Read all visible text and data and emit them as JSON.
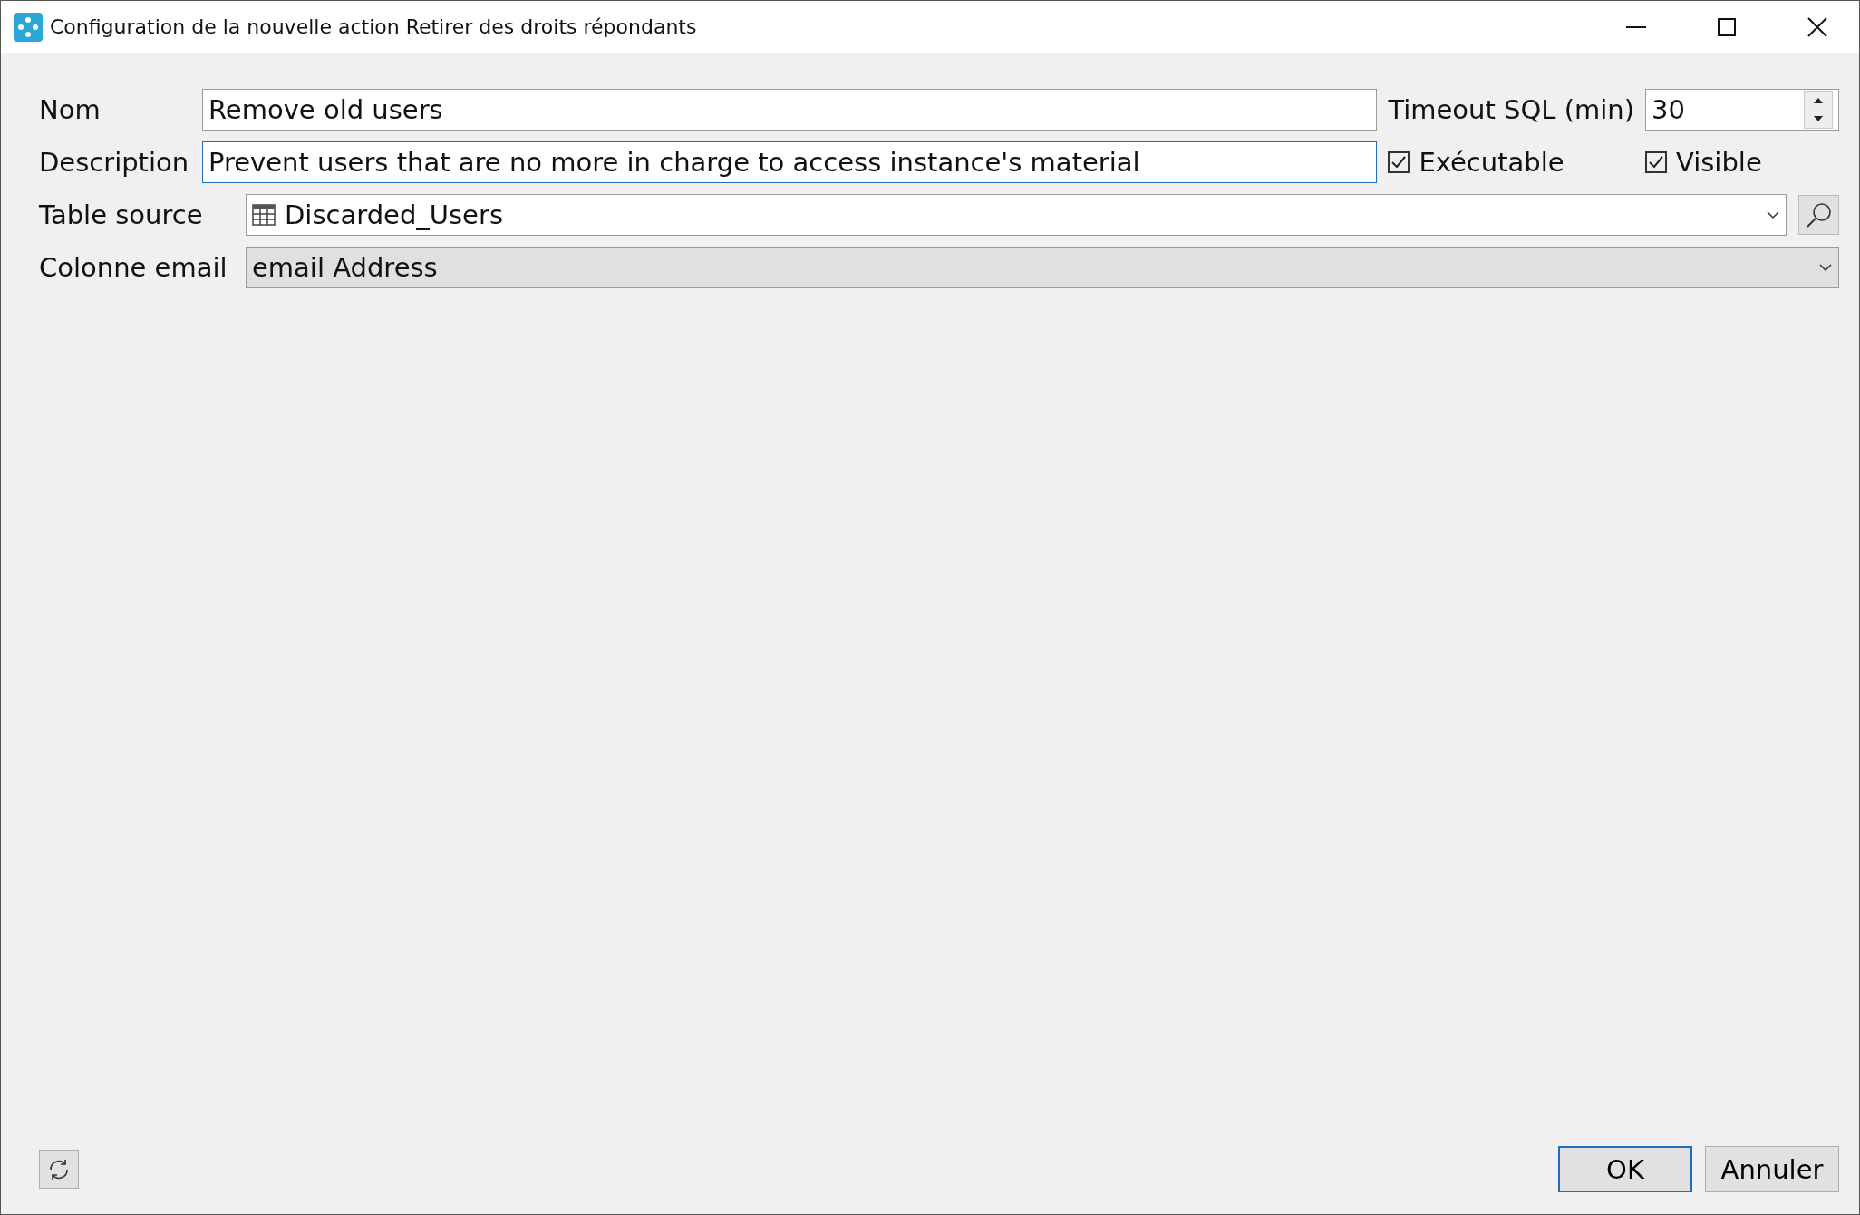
{
  "window": {
    "title": "Configuration de la nouvelle action Retirer des droits répondants"
  },
  "name": {
    "label": "Nom",
    "value": "Remove old users",
    "focused": false
  },
  "description": {
    "label": "Description",
    "value": "Prevent users that are no more in charge to access instance's material",
    "focused": true
  },
  "timeout": {
    "label": "Timeout SQL (min)",
    "value": "30"
  },
  "checkboxes": [
    {
      "label": "Exécutable",
      "checked": true
    },
    {
      "label": "Visible",
      "checked": true
    }
  ],
  "table_source": {
    "label": "Table source",
    "value": "Discarded_Users",
    "disabled": false
  },
  "email_column": {
    "label": "Colonne email",
    "value": "email Address",
    "disabled": true
  },
  "buttons": [
    {
      "label": "OK",
      "default": true
    },
    {
      "label": "Annuler",
      "default": false
    }
  ]
}
